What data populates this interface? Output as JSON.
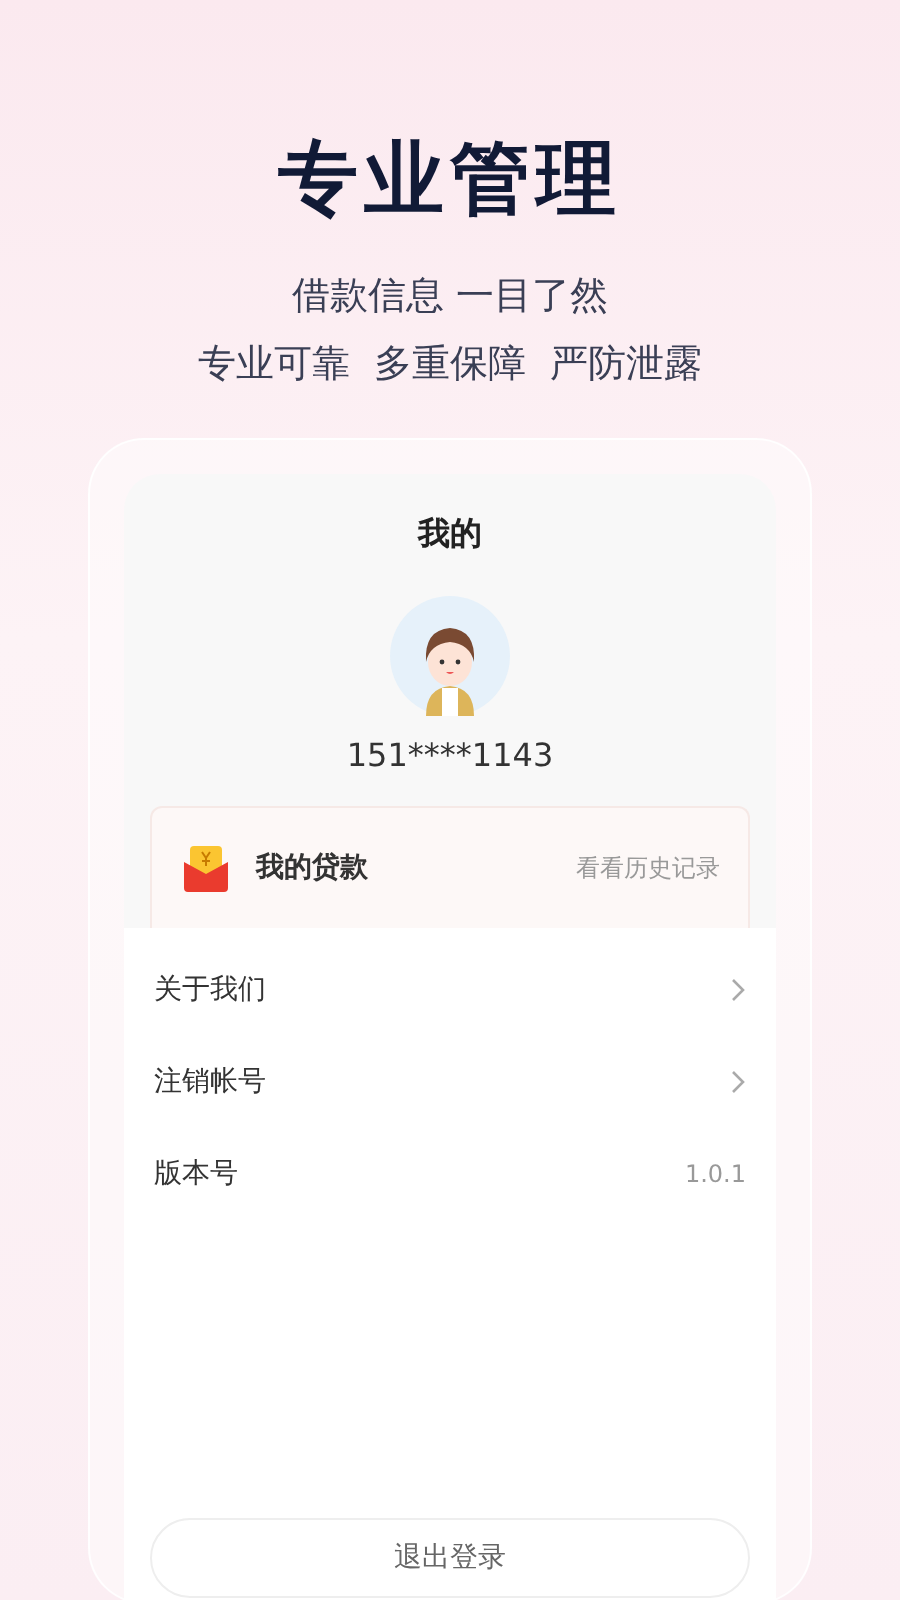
{
  "headline": "专业管理",
  "taglines": [
    "借款信息 一目了然",
    "专业可靠  多重保障  严防泄露"
  ],
  "screen": {
    "title": "我的",
    "phone": "151****1143",
    "loan_card": {
      "label": "我的贷款",
      "link": "看看历史记录"
    },
    "menu": [
      {
        "kind": "link",
        "label": "关于我们"
      },
      {
        "kind": "link",
        "label": "注销帐号"
      },
      {
        "kind": "value",
        "label": "版本号",
        "value": "1.0.1"
      }
    ],
    "logout": "退出登录"
  }
}
